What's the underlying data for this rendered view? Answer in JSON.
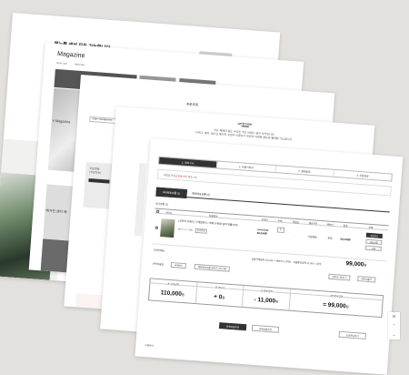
{
  "card1": {
    "heading": "메뉴를 생성 모두 가능합니다"
  },
  "card2": {
    "title": "Magazine",
    "nav": [
      "Item one",
      "Item two"
    ],
    "label": "# Magazine",
    "label2": "메거진 센터 예"
  },
  "card3": {
    "title": "주문조회",
    "tab": "order management",
    "lines": [
      "주문현황",
      "(주문정보)"
    ]
  },
  "card4": {
    "welcome": "welcome",
    "desc1": "쿠뉴 페페리 없는 무리는 주는 브랜드 임무 포커입니다.",
    "desc2": "아무다, 웨이, 페이은 페이의 수면이 이용하기 위하여 다양한 불도와 들에를 가능합니다."
  },
  "card5": {
    "steps": [
      {
        "label": "1. 장바구니",
        "active": true
      },
      {
        "label": "2. 주문서작성",
        "active": false
      },
      {
        "label": "3. 결제완료",
        "active": false
      },
      {
        "label": "4. 주문완료",
        "active": false
      }
    ],
    "notice_prefix": "적립금",
    "notice_red": "적립금 받을 회원",
    "notice_suffix": "적립 -2%",
    "tabs": [
      {
        "label": "국내배송상품 (1)",
        "active": true
      },
      {
        "label": "해외배송상품 (0)",
        "active": false
      }
    ],
    "count_label": "국내상품 (1)",
    "headers": [
      "이미지",
      "상품정보",
      "판매가",
      "수량",
      "적립금",
      "배송구분",
      "배송비",
      "합계",
      "선택"
    ],
    "item": {
      "name": "[국민위 브랜드] 구례엔토리 / 데메 트위랑 실버 단품(1개)",
      "option": "[옵션: 1+1 다발]",
      "option_btn": "옵션변경",
      "price_orig": "110,000원",
      "price": "99,000원",
      "qty": "1",
      "points": "-",
      "ship_type": "기본배송",
      "ship_fee": "무료",
      "total": "99,000원",
      "btn_order": "주문하기",
      "btn_wish": "관심상품",
      "btn_delete": "삭제"
    },
    "basic_label": "[기본배송]",
    "subtotal_text": "상품구매금액 110,000 + 배송비 0 (무료) - 상품할인금액 11,000 = 합계 :",
    "total": "99,000",
    "total_unit": "원",
    "action_label": "선택상품을",
    "action_btns": [
      "삭제하기",
      "해외배송상품 장바구니로 이동"
    ],
    "right_btns": [
      "장바구니비우기",
      "견적서출력"
    ],
    "summary": [
      {
        "key": "총 상품금액",
        "value": "110,000",
        "unit": "원"
      },
      {
        "key": "총 배송비",
        "value": "+ 0",
        "unit": "원"
      },
      {
        "key": "총 할인금액",
        "value": "- 11,000",
        "unit": "원"
      },
      {
        "key": "결제예정금액",
        "value": "= 99,000",
        "unit": "원"
      }
    ],
    "btn_all": "전체상품주문",
    "btn_selected": "선택상품주문",
    "btn_continue": "쇼핑계속하기",
    "footer_text": "이용안내"
  }
}
